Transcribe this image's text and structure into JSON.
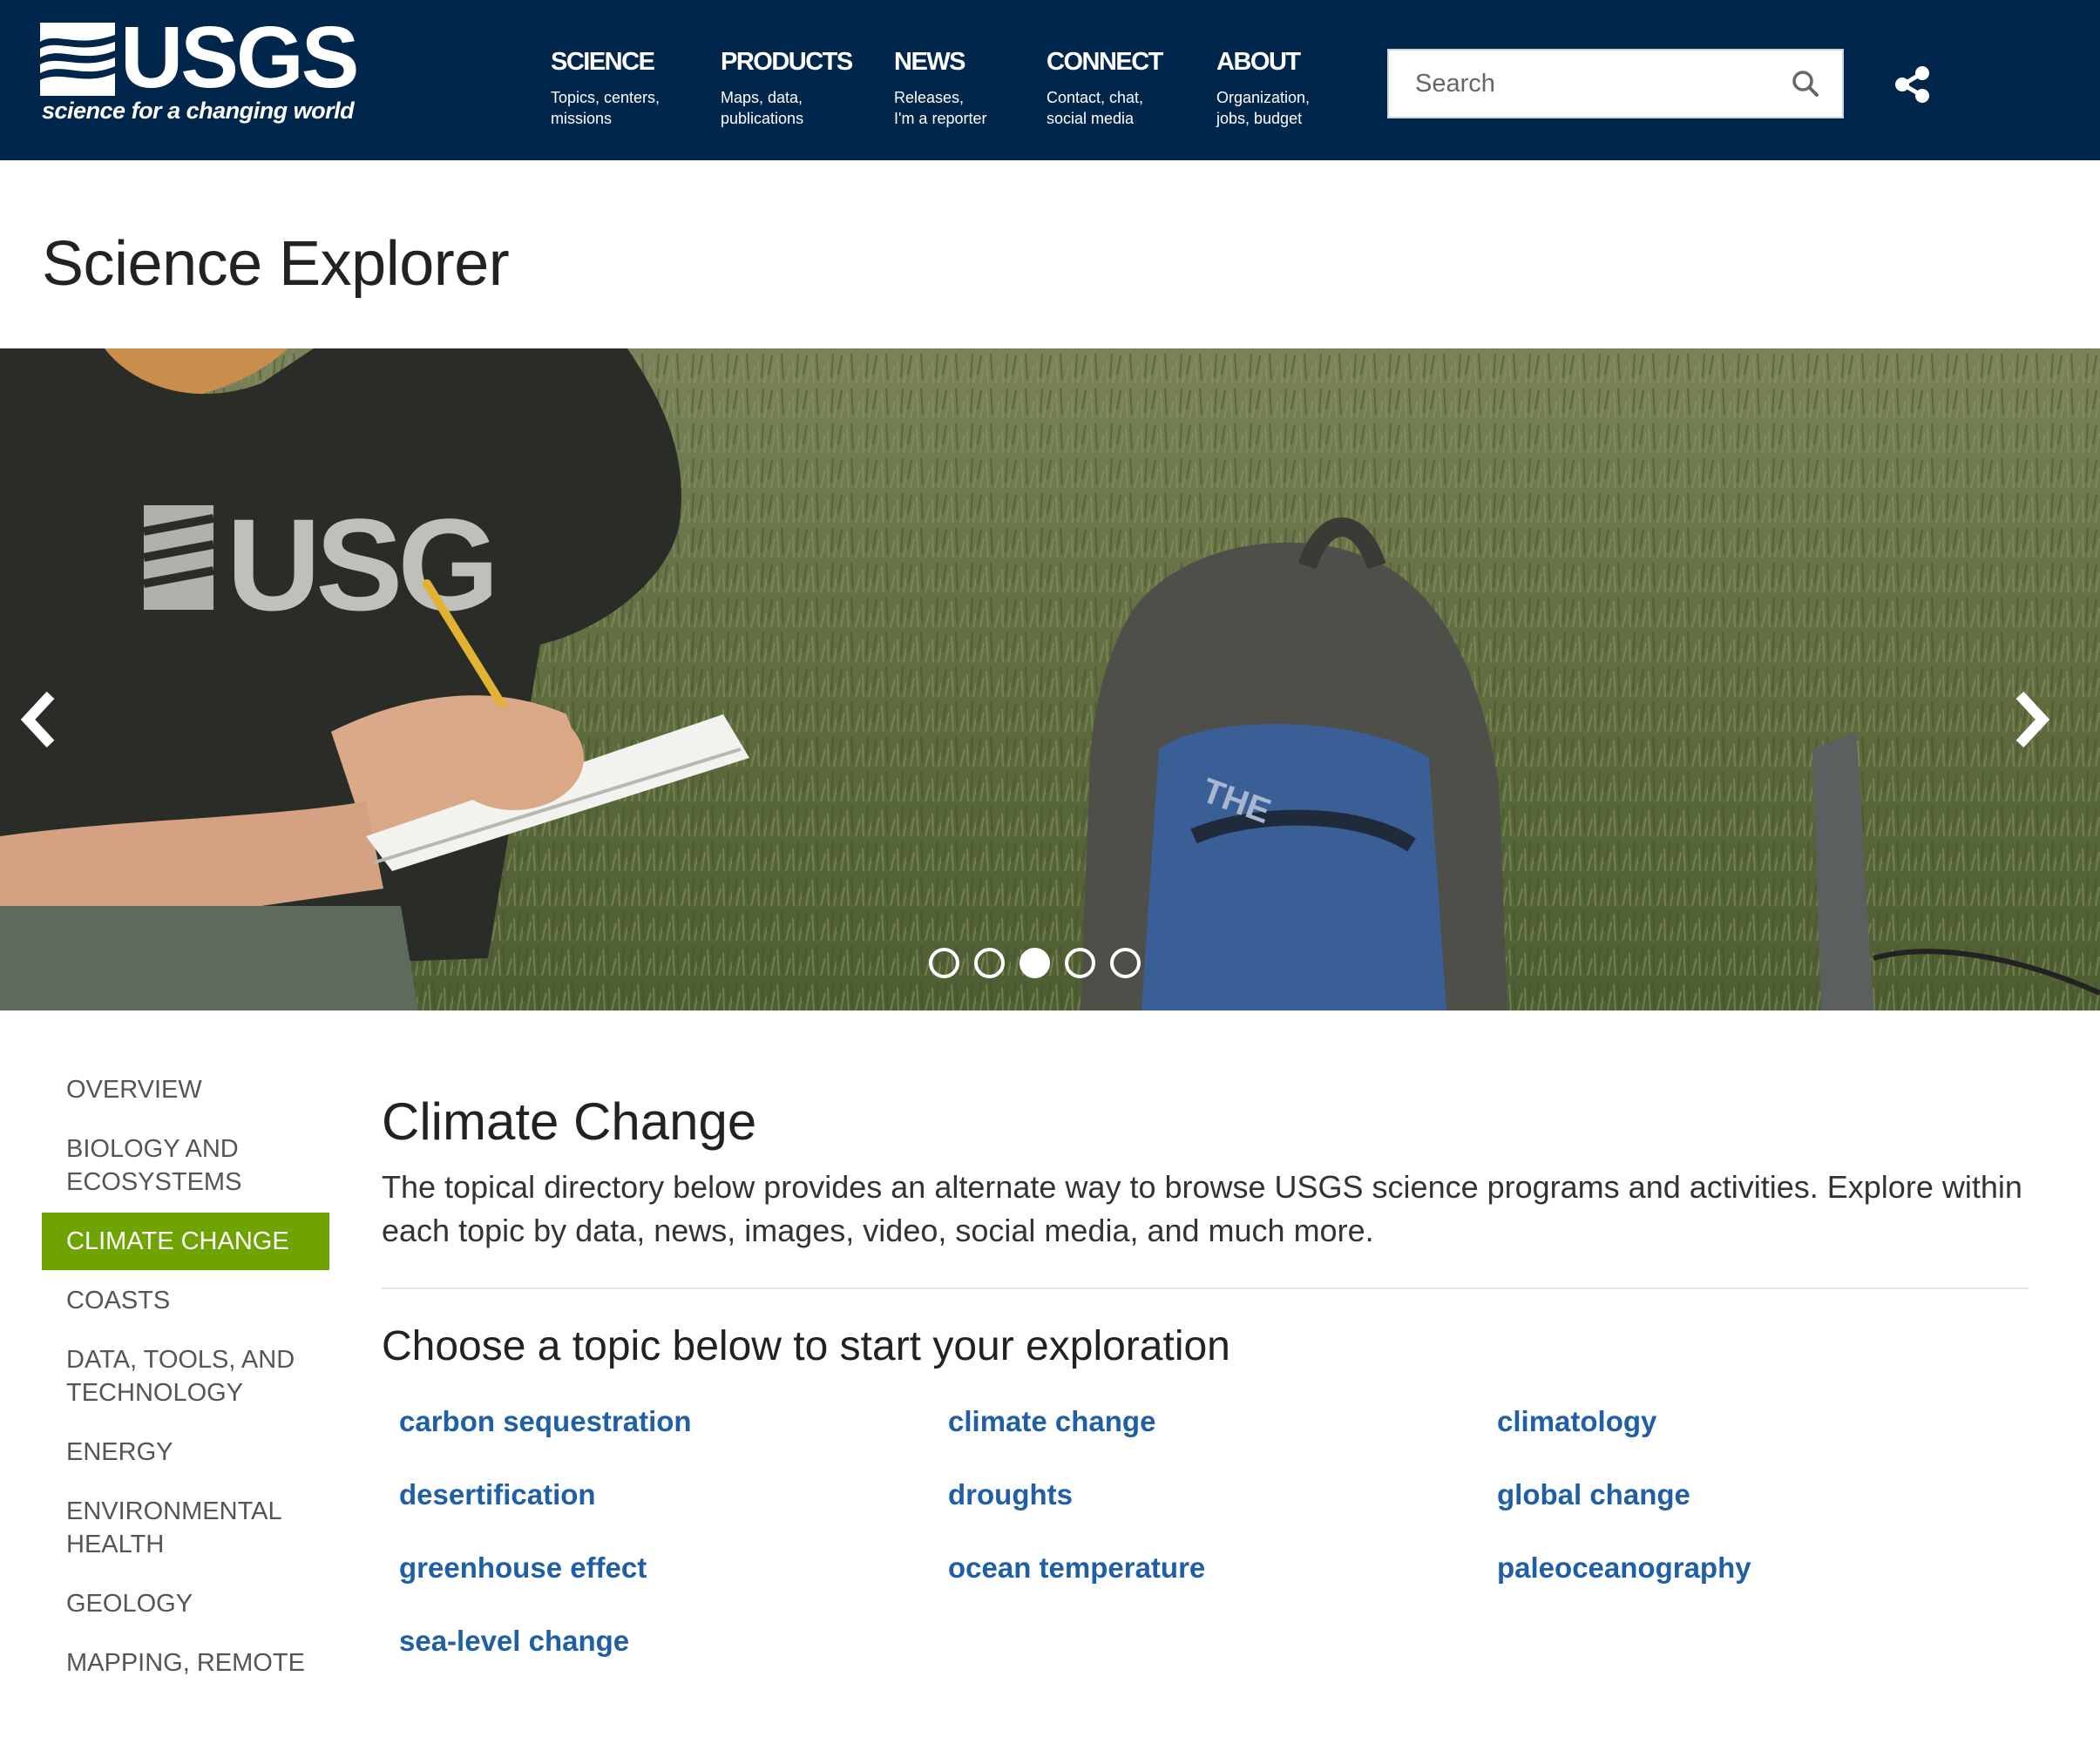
{
  "header": {
    "logo_text": "USGS",
    "logo_tagline": "science for a changing world",
    "nav": [
      {
        "title": "SCIENCE",
        "sub": "Topics, centers,\nmissions"
      },
      {
        "title": "PRODUCTS",
        "sub": "Maps, data,\npublications"
      },
      {
        "title": "NEWS",
        "sub": "Releases,\nI'm a reporter"
      },
      {
        "title": "CONNECT",
        "sub": "Contact, chat,\nsocial media"
      },
      {
        "title": "ABOUT",
        "sub": "Organization,\njobs, budget"
      }
    ],
    "search_placeholder": "Search",
    "icons": {
      "search": "search-icon",
      "share": "share-icon"
    }
  },
  "page_title": "Science Explorer",
  "carousel": {
    "slide_count": 5,
    "active_index": 2
  },
  "sidebar": {
    "items": [
      {
        "label": "OVERVIEW",
        "active": false
      },
      {
        "label": "BIOLOGY AND\nECOSYSTEMS",
        "active": false
      },
      {
        "label": "CLIMATE CHANGE",
        "active": true
      },
      {
        "label": "COASTS",
        "active": false
      },
      {
        "label": "DATA, TOOLS, AND\nTECHNOLOGY",
        "active": false
      },
      {
        "label": "ENERGY",
        "active": false
      },
      {
        "label": "ENVIRONMENTAL\nHEALTH",
        "active": false
      },
      {
        "label": "GEOLOGY",
        "active": false
      },
      {
        "label": "MAPPING, REMOTE",
        "active": false
      }
    ]
  },
  "main": {
    "heading": "Climate Change",
    "intro": "The topical directory below provides an alternate way to browse USGS science programs and activities. Explore within each topic by data, news, images, video, social media, and much more.",
    "subheading": "Choose a topic below to start your exploration",
    "topics": [
      "carbon sequestration",
      "climate change",
      "climatology",
      "desertification",
      "droughts",
      "global change",
      "greenhouse effect",
      "ocean temperature",
      "paleoceanography",
      "sea-level change"
    ]
  },
  "colors": {
    "header_bg": "#00264c",
    "active_green": "#6fa400",
    "link_blue": "#1f5fa6"
  }
}
